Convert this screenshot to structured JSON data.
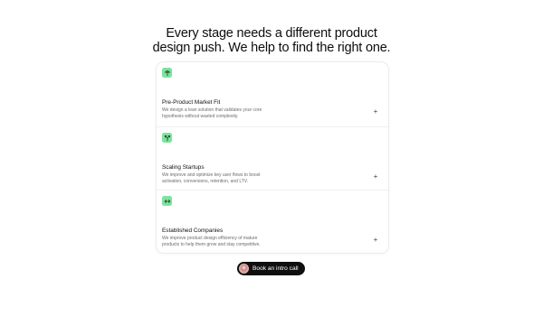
{
  "headline": {
    "line1": "Every stage needs a different product",
    "line2": "design push. We help to find the right one."
  },
  "stages": [
    {
      "icon": "signal-tower-icon",
      "title": "Pre-Product Market Fit",
      "desc_line1": "We design a lean solution that validates your core",
      "desc_line2": "hypothesis without wasted complexity.",
      "expand": "+"
    },
    {
      "icon": "branch-arrows-icon",
      "title": "Scaling Startups",
      "desc_line1": "We improve and optimize key user flows to boost",
      "desc_line2": "activation, conversions, retention, and LTV.",
      "expand": "+"
    },
    {
      "icon": "double-arrow-icon",
      "title": "Established Companies",
      "desc_line1": "We improve product design efficiency of mature",
      "desc_line2": "products to help them grow and stay competitive.",
      "expand": "+"
    }
  ],
  "cta": {
    "label": "Book an intro call"
  },
  "colors": {
    "accent_green": "#7ee29e",
    "cta_background": "#0f0f0f"
  }
}
